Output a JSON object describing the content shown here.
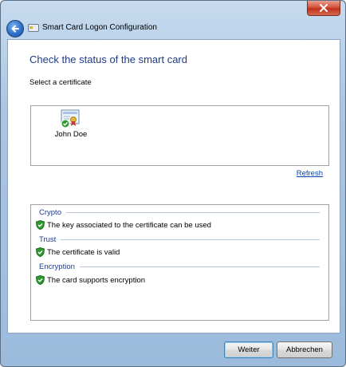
{
  "window": {
    "title": "Smart Card Logon Configuration"
  },
  "main": {
    "heading": "Check the status of the smart card",
    "select_label": "Select a certificate",
    "certificates": [
      {
        "name": "John Doe"
      }
    ],
    "refresh_label": "Refresh"
  },
  "status": {
    "groups": [
      {
        "title": "Crypto",
        "items": [
          "The key associated to the certificate can be used"
        ]
      },
      {
        "title": "Trust",
        "items": [
          "The certificate is valid"
        ]
      },
      {
        "title": "Encryption",
        "items": [
          "The card supports encryption"
        ]
      }
    ]
  },
  "buttons": {
    "next": "Weiter",
    "cancel": "Abbrechen"
  },
  "colors": {
    "accent": "#1e3a8a",
    "link": "#0645ad",
    "ok": "#2e9a2e"
  },
  "icons": {
    "close": "close-icon",
    "back": "back-arrow-icon",
    "certificate": "certificate-icon",
    "check": "shield-check-icon"
  }
}
